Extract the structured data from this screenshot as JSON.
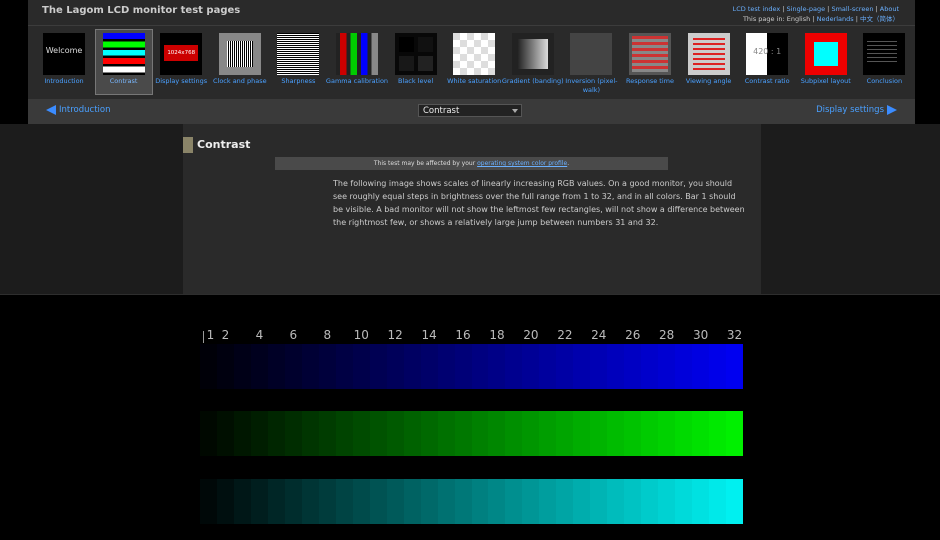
{
  "site": {
    "title": "The Lagom LCD monitor test pages",
    "links": {
      "index": "LCD test index",
      "single": "Single-page",
      "small": "Small-screen",
      "about": "About",
      "lang_prefix": "This page in: English |",
      "lang_nl": "Nederlands",
      "lang_zh": "中文（简体）"
    }
  },
  "thumbs": [
    {
      "label": "Introduction",
      "icon": "welcome-icon",
      "text": "Welcome"
    },
    {
      "label": "Contrast",
      "icon": "contrast-icon",
      "active": true
    },
    {
      "label": "Display settings",
      "icon": "display-settings-icon",
      "text": "1024x768"
    },
    {
      "label": "Clock and phase",
      "icon": "clock-phase-icon"
    },
    {
      "label": "Sharpness",
      "icon": "sharpness-icon"
    },
    {
      "label": "Gamma calibration",
      "icon": "gamma-icon"
    },
    {
      "label": "Black level",
      "icon": "black-level-icon"
    },
    {
      "label": "White saturation",
      "icon": "white-saturation-icon"
    },
    {
      "label": "Gradient (banding)",
      "icon": "gradient-icon"
    },
    {
      "label": "Inversion (pixel-walk)",
      "icon": "inversion-icon"
    },
    {
      "label": "Response time",
      "icon": "response-time-icon"
    },
    {
      "label": "Viewing angle",
      "icon": "viewing-angle-icon"
    },
    {
      "label": "Contrast ratio",
      "icon": "contrast-ratio-icon",
      "text": "420 : 1"
    },
    {
      "label": "Subpixel layout",
      "icon": "subpixel-layout-icon"
    },
    {
      "label": "Conclusion",
      "icon": "conclusion-icon"
    }
  ],
  "nav": {
    "prev": "Introduction",
    "next": "Display settings",
    "select_value": "Contrast"
  },
  "content": {
    "title": "Contrast",
    "notice_prefix": "This test may be affected by your",
    "notice_link": "operating system color profile",
    "notice_suffix": ".",
    "description": "The following image shows scales of linearly increasing RGB values. On a good monitor, you should see roughly equal steps in brightness over the full range from 1 to 32, and in all colors. Bar 1 should be visible. A bad monitor will not show the leftmost few rectangles, will not show a difference between the rightmost few, or shows a relatively large jump between numbers 31 and 32."
  },
  "scale": {
    "numbers": [
      "1",
      "2",
      "4",
      "6",
      "8",
      "10",
      "12",
      "14",
      "16",
      "18",
      "20",
      "22",
      "24",
      "26",
      "28",
      "30",
      "32"
    ],
    "steps": 32,
    "bars": [
      {
        "name": "blue-bar",
        "color": "#0000ff"
      },
      {
        "name": "green-bar",
        "color": "#00ff00"
      },
      {
        "name": "cyan-bar",
        "color": "#00ffff"
      }
    ]
  }
}
